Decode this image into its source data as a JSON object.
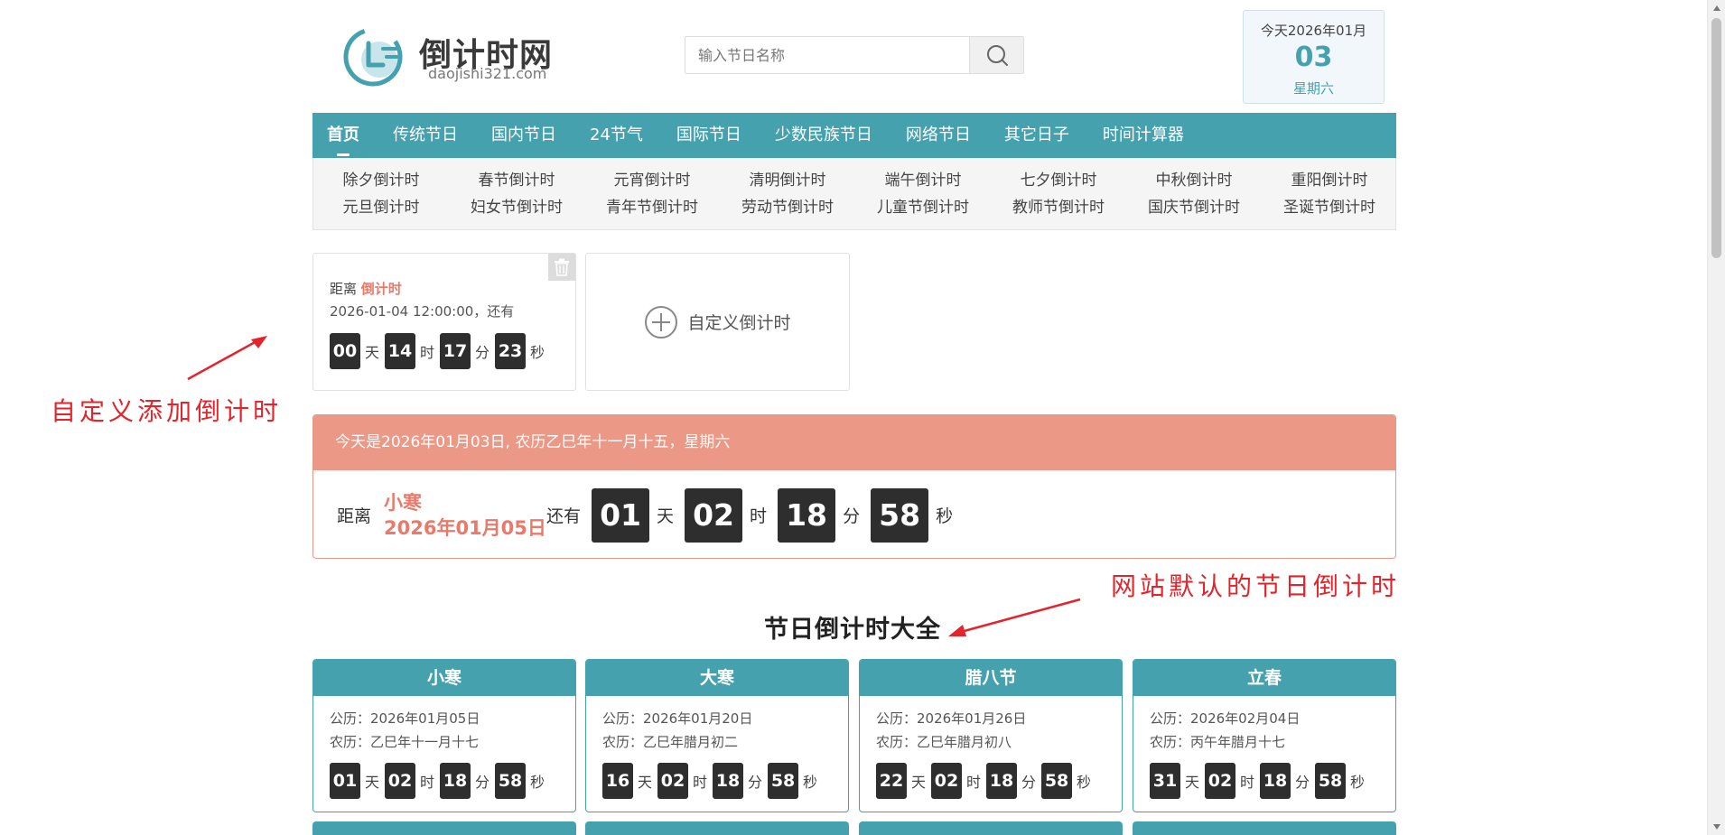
{
  "header": {
    "logo_title": "倒计时网",
    "logo_domain": "daojishi321.com",
    "search_placeholder": "输入节日名称",
    "today_line": "今天2026年01月",
    "today_day": "03",
    "today_weekday": "星期六"
  },
  "nav": {
    "items": [
      "首页",
      "传统节日",
      "国内节日",
      "24节气",
      "国际节日",
      "少数民族节日",
      "网络节日",
      "其它日子",
      "时间计算器"
    ]
  },
  "subnav": {
    "items": [
      "除夕倒计时",
      "春节倒计时",
      "元宵倒计时",
      "清明倒计时",
      "端午倒计时",
      "七夕倒计时",
      "中秋倒计时",
      "重阳倒计时",
      "元旦倒计时",
      "妇女节倒计时",
      "青年节倒计时",
      "劳动节倒计时",
      "儿童节倒计时",
      "教师节倒计时",
      "国庆节倒计时",
      "圣诞节倒计时"
    ]
  },
  "custom_card": {
    "prefix": "距离",
    "name": "倒计时",
    "target": "2026-01-04 12:00:00，还有",
    "days": "00",
    "hours": "14",
    "minutes": "17",
    "seconds": "23"
  },
  "add_card": {
    "label": "自定义倒计时"
  },
  "units": {
    "day": "天",
    "hour": "时",
    "minute": "分",
    "second": "秒"
  },
  "annotations": {
    "custom": "自定义添加倒计时",
    "default": "网站默认的节日倒计时"
  },
  "banner": {
    "today_text": "今天是2026年01月03日, 农历乙巳年十一月十五，星期六",
    "distance_label": "距离",
    "festival_name": "小寒",
    "festival_date": "2026年01月05日",
    "remain_label": "还有",
    "days": "01",
    "hours": "02",
    "minutes": "18",
    "seconds": "58"
  },
  "section_title": "节日倒计时大全",
  "festivals": [
    {
      "name": "小寒",
      "solar": "公历：2026年01月05日",
      "lunar": "农历：乙巳年十一月十七",
      "days": "01",
      "hours": "02",
      "minutes": "18",
      "seconds": "58"
    },
    {
      "name": "大寒",
      "solar": "公历：2026年01月20日",
      "lunar": "农历：乙巳年腊月初二",
      "days": "16",
      "hours": "02",
      "minutes": "18",
      "seconds": "58"
    },
    {
      "name": "腊八节",
      "solar": "公历：2026年01月26日",
      "lunar": "农历：乙巳年腊月初八",
      "days": "22",
      "hours": "02",
      "minutes": "18",
      "seconds": "58"
    },
    {
      "name": "立春",
      "solar": "公历：2026年02月04日",
      "lunar": "农历：丙午年腊月十七",
      "days": "31",
      "hours": "02",
      "minutes": "18",
      "seconds": "58"
    }
  ],
  "colors": {
    "teal": "#45a1ae",
    "salmon": "#ec9886",
    "accent_red": "#e97a69",
    "annotation_red": "#e3242b",
    "digit_bg": "#2e2e2e"
  }
}
